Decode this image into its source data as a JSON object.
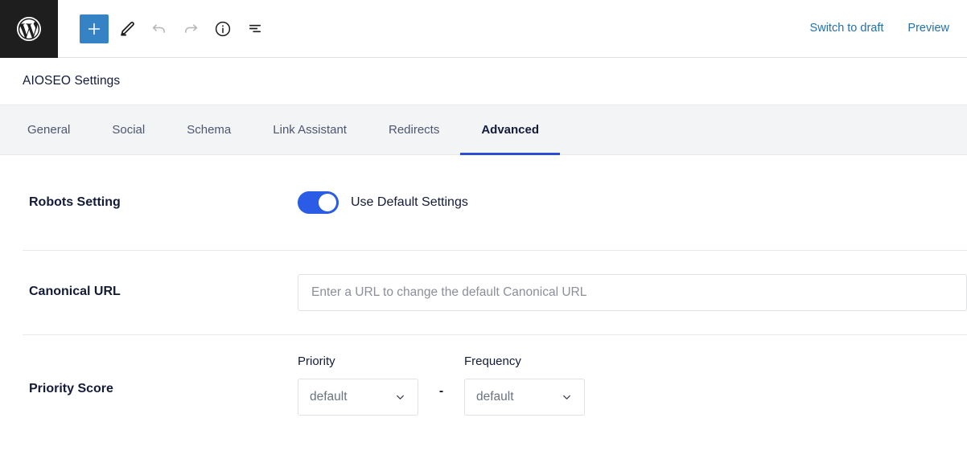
{
  "toolbar": {
    "logo_icon": "wordpress-logo-icon",
    "tools": [
      {
        "name": "add-block-button",
        "icon": "plus-icon",
        "label": "Add block",
        "state": "primary"
      },
      {
        "name": "edit-tool-button",
        "icon": "pencil-icon",
        "label": "Tools",
        "state": "normal"
      },
      {
        "name": "undo-button",
        "icon": "undo-icon",
        "label": "Undo",
        "state": "disabled"
      },
      {
        "name": "redo-button",
        "icon": "redo-icon",
        "label": "Redo",
        "state": "disabled"
      },
      {
        "name": "details-button",
        "icon": "info-icon",
        "label": "Details",
        "state": "normal"
      },
      {
        "name": "list-view-button",
        "icon": "list-view-icon",
        "label": "List View",
        "state": "normal"
      }
    ],
    "switch_to_draft": "Switch to draft",
    "preview": "Preview"
  },
  "panel": {
    "title": "AIOSEO Settings",
    "tabs": [
      {
        "label": "General",
        "active": false
      },
      {
        "label": "Social",
        "active": false
      },
      {
        "label": "Schema",
        "active": false
      },
      {
        "label": "Link Assistant",
        "active": false
      },
      {
        "label": "Redirects",
        "active": false
      },
      {
        "label": "Advanced",
        "active": true
      }
    ]
  },
  "settings": {
    "robots": {
      "label": "Robots Setting",
      "toggle_label": "Use Default Settings",
      "toggle_on": true
    },
    "canonical": {
      "label": "Canonical URL",
      "value": "",
      "placeholder": "Enter a URL to change the default Canonical URL"
    },
    "priority": {
      "label": "Priority Score",
      "priority_label": "Priority",
      "priority_value": "default",
      "separator": "-",
      "frequency_label": "Frequency",
      "frequency_value": "default"
    }
  },
  "colors": {
    "wp_blue": "#3582c4",
    "link_blue": "#2271b1",
    "toggle_blue": "#2b5ce6",
    "tab_active_underline": "#2b4dd8",
    "dark_bg": "#1e1e1e",
    "tabbar_bg": "#f3f4f5",
    "text_dark": "#141b38"
  }
}
